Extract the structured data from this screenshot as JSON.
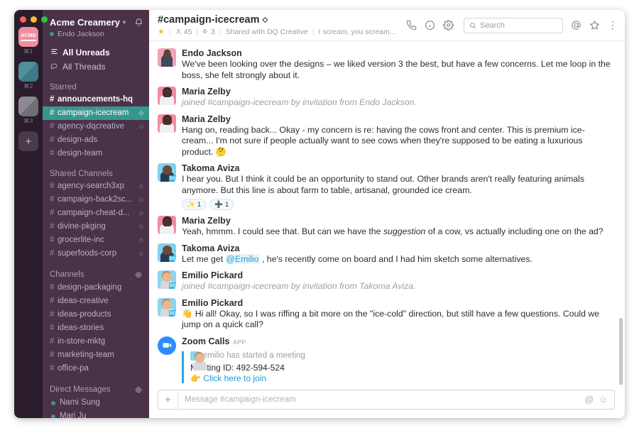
{
  "window": {
    "controls": [
      "close",
      "minimize",
      "zoom"
    ]
  },
  "rail": {
    "workspaces": [
      {
        "name": "Acme",
        "label": "ACME",
        "key": "⌘1",
        "color": "#f08ea0",
        "active": true
      },
      {
        "name": "teal-workspace",
        "label": "",
        "key": "⌘2",
        "color": "#4f8f99",
        "active": false
      },
      {
        "name": "gray-workspace",
        "label": "",
        "key": "⌘3",
        "color": "#8a8a90",
        "active": false
      }
    ],
    "add_label": "+"
  },
  "sidebar": {
    "team_name": "Acme Creamery",
    "chevron": "▾",
    "bell_icon": "notifications-bell",
    "user_name": "Endo Jackson",
    "user_presence": "online",
    "nav": [
      {
        "label": "All Unreads",
        "icon": "unreads-icon",
        "bold": true
      },
      {
        "label": "All Threads",
        "icon": "threads-icon",
        "bold": false
      }
    ],
    "groups": [
      {
        "title": "Starred",
        "add": false,
        "channels": [
          {
            "name": "announcements-hq",
            "state": "unread",
            "shared": false
          },
          {
            "name": "campaign-icecream",
            "state": "active",
            "shared": true
          },
          {
            "name": "agency-dqcreative",
            "state": "normal",
            "shared": true
          },
          {
            "name": "design-ads",
            "state": "normal",
            "shared": false
          },
          {
            "name": "design-team",
            "state": "normal",
            "shared": false
          }
        ]
      },
      {
        "title": "Shared Channels",
        "add": false,
        "channels": [
          {
            "name": "agency-search3xp",
            "state": "normal",
            "shared": true
          },
          {
            "name": "campaign-back2sc...",
            "state": "normal",
            "shared": true
          },
          {
            "name": "campaign-cheat-d...",
            "state": "normal",
            "shared": true
          },
          {
            "name": "divine-pkging",
            "state": "normal",
            "shared": true
          },
          {
            "name": "grocerlite-inc",
            "state": "normal",
            "shared": true
          },
          {
            "name": "superfoods-corp",
            "state": "normal",
            "shared": true
          }
        ]
      },
      {
        "title": "Channels",
        "add": true,
        "channels": [
          {
            "name": "design-packaging",
            "state": "normal",
            "shared": false
          },
          {
            "name": "ideas-creative",
            "state": "normal",
            "shared": false
          },
          {
            "name": "ideas-products",
            "state": "normal",
            "shared": false
          },
          {
            "name": "ideas-stories",
            "state": "normal",
            "shared": false
          },
          {
            "name": "in-store-mktg",
            "state": "normal",
            "shared": false
          },
          {
            "name": "marketing-team",
            "state": "normal",
            "shared": false
          },
          {
            "name": "office-pa",
            "state": "normal",
            "shared": false
          }
        ]
      }
    ],
    "dm_group": {
      "title": "Direct Messages",
      "add": true,
      "people": [
        {
          "name": "Nami Sung",
          "presence": "online"
        },
        {
          "name": "Mari Ju",
          "presence": "online"
        }
      ]
    }
  },
  "header": {
    "channel_title": "#campaign-icecream",
    "shared_glyph": "⬦",
    "starred": true,
    "star_glyph": "★",
    "members_icon": "person-icon",
    "members_count": "45",
    "pins_icon": "pin-icon",
    "pins_count": "3",
    "shared_with": "Shared with DQ Creative",
    "topic": "I scream, you scream...",
    "icons": [
      {
        "name": "call-icon",
        "glyph": "✆"
      },
      {
        "name": "info-icon",
        "glyph": "ⓘ"
      },
      {
        "name": "settings-gear-icon",
        "glyph": "⚙"
      }
    ],
    "search": {
      "placeholder": "Search",
      "icon": "search-icon",
      "value": ""
    },
    "right_icons": [
      {
        "name": "mentions-icon",
        "glyph": "@"
      },
      {
        "name": "starred-items-icon",
        "glyph": "☆"
      },
      {
        "name": "more-options-icon",
        "glyph": "⋮"
      }
    ]
  },
  "messages": [
    {
      "author": "Endo Jackson",
      "avatar": "f-endo",
      "badge": "",
      "type": "text",
      "text": "We've been looking over the designs – we liked version 3 the best, but have a few concerns. Let me loop in the boss, she felt strongly about it."
    },
    {
      "author": "Maria Zelby",
      "avatar": "f-maria",
      "badge": "",
      "type": "system",
      "text": "joined #campaign-icecream by invitation from Endo Jackson."
    },
    {
      "author": "Maria Zelby",
      "avatar": "f-maria",
      "badge": "",
      "type": "text",
      "text": "Hang on, reading back... Okay - my concern is re: having the cows front and center. This is premium ice-cream... I'm not sure if people actually want to see cows when they're supposed to be eating a luxurious product. 🤔"
    },
    {
      "author": "Takoma Aviza",
      "avatar": "f-takoma",
      "badge": "DQ",
      "type": "text",
      "text": "I hear you. But I think it could be an opportunity to stand out. Other brands aren't really featuring animals anymore. But this line is about farm to table, artisanal, grounded ice cream.",
      "reactions": [
        {
          "emoji": "✨",
          "count": "1"
        },
        {
          "emoji": "➕",
          "count": "1"
        }
      ]
    },
    {
      "author": "Maria Zelby",
      "avatar": "f-maria",
      "badge": "",
      "type": "rich",
      "parts": [
        {
          "kind": "plain",
          "text": "Yeah, hmmm. I could see that. But can we have the "
        },
        {
          "kind": "italic",
          "text": "suggestion"
        },
        {
          "kind": "plain",
          "text": " of a cow, vs actually including one on the ad?"
        }
      ]
    },
    {
      "author": "Takoma Aviza",
      "avatar": "f-takoma",
      "badge": "DQ",
      "type": "rich",
      "parts": [
        {
          "kind": "plain",
          "text": "Let me get "
        },
        {
          "kind": "mention",
          "text": "@Emilio"
        },
        {
          "kind": "plain",
          "text": " , he's recently come on board and I had him sketch some alternatives."
        }
      ]
    },
    {
      "author": "Emilio Pickard",
      "avatar": "f-emilio",
      "badge": "DQ",
      "type": "system",
      "text": "joined #campaign-icecream by invitation from Takoma Aviza."
    },
    {
      "author": "Emilio Pickard",
      "avatar": "f-emilio",
      "badge": "DQ",
      "type": "text",
      "text": "👋  Hi all! Okay, so I was riffing a bit more on the \"ice-cold\" direction, but still have a few questions. Could we jump on a quick call?"
    },
    {
      "author": "Zoom Calls",
      "avatar": "zoom",
      "badge": "",
      "app_tag": "APP",
      "type": "attachment",
      "attachment": {
        "started_by": "emilio has started a meeting",
        "meeting_id_label": "Meeting ID: 492-594-524",
        "join_emoji": "👉",
        "join_label": "Click here to join"
      }
    }
  ],
  "composer": {
    "plus_label": "+",
    "placeholder": "Message #campaign-icecream",
    "value": "",
    "icons": [
      {
        "name": "mention-icon",
        "glyph": "@"
      },
      {
        "name": "emoji-icon",
        "glyph": "☺"
      }
    ]
  }
}
